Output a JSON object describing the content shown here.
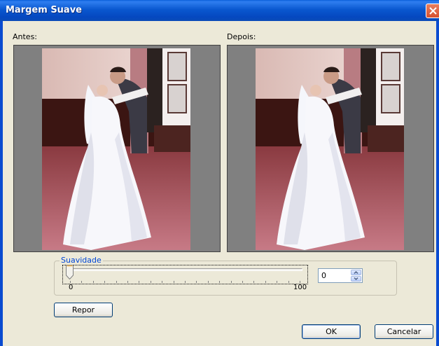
{
  "window": {
    "title": "Margem Suave"
  },
  "labels": {
    "before": "Antes:",
    "after": "Depois:"
  },
  "softness": {
    "group_label": "Suavidade",
    "value": "0",
    "min_label": "0",
    "max_label": "100",
    "level": 0
  },
  "buttons": {
    "reset": "Repor",
    "ok": "OK",
    "cancel": "Cancelar"
  },
  "icons": {
    "close": "close-icon",
    "spin_up": "arrow-up-icon",
    "spin_down": "arrow-down-icon"
  },
  "colors": {
    "titlebar": "#0a58d0",
    "dialog_bg": "#ece9d8",
    "close_button": "#d6502e",
    "accent": "#0046d5"
  }
}
